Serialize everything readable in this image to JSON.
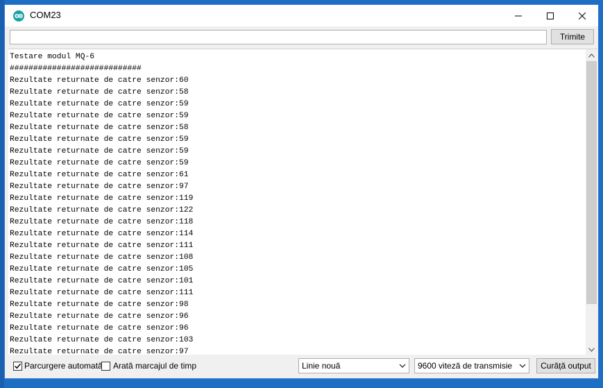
{
  "window": {
    "title": "COM23"
  },
  "input": {
    "value": "",
    "send_label": "Trimite"
  },
  "output": {
    "lines": [
      "Testare modul MQ-6",
      "############################",
      "Rezultate returnate de catre senzor:60",
      "Rezultate returnate de catre senzor:58",
      "Rezultate returnate de catre senzor:59",
      "Rezultate returnate de catre senzor:59",
      "Rezultate returnate de catre senzor:58",
      "Rezultate returnate de catre senzor:59",
      "Rezultate returnate de catre senzor:59",
      "Rezultate returnate de catre senzor:59",
      "Rezultate returnate de catre senzor:61",
      "Rezultate returnate de catre senzor:97",
      "Rezultate returnate de catre senzor:119",
      "Rezultate returnate de catre senzor:122",
      "Rezultate returnate de catre senzor:118",
      "Rezultate returnate de catre senzor:114",
      "Rezultate returnate de catre senzor:111",
      "Rezultate returnate de catre senzor:108",
      "Rezultate returnate de catre senzor:105",
      "Rezultate returnate de catre senzor:101",
      "Rezultate returnate de catre senzor:111",
      "Rezultate returnate de catre senzor:98",
      "Rezultate returnate de catre senzor:96",
      "Rezultate returnate de catre senzor:96",
      "Rezultate returnate de catre senzor:103",
      "Rezultate returnate de catre senzor:97"
    ]
  },
  "footer": {
    "autoscroll_label": "Parcurgere automată",
    "autoscroll_checked": true,
    "timestamp_label": "Arată marcajul de timp",
    "timestamp_checked": false,
    "line_ending": "Linie nouă",
    "baud_rate": "9600 viteză de transmisie",
    "clear_label": "Curăță output"
  }
}
